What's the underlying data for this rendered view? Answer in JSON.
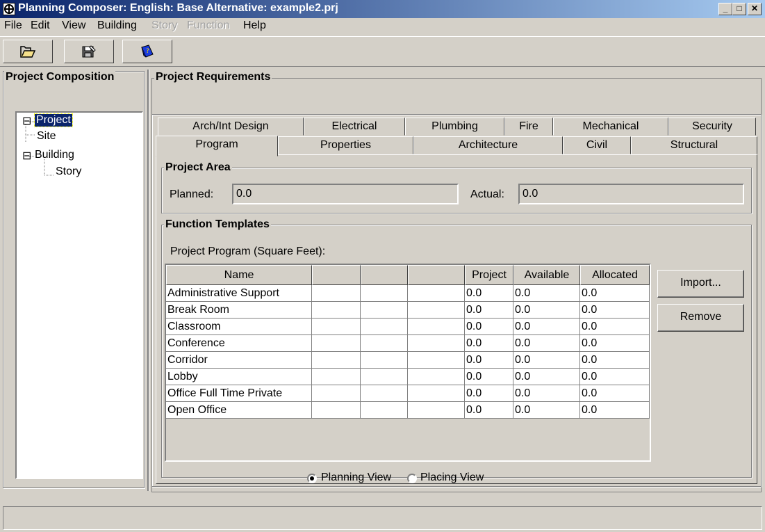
{
  "window": {
    "title": "Planning Composer: English: Base Alternative: example2.prj",
    "minimize": "_",
    "maximize": "□",
    "close": "✕"
  },
  "menu": [
    {
      "label": "File",
      "enabled": true
    },
    {
      "label": "Edit",
      "enabled": true
    },
    {
      "label": "View",
      "enabled": true
    },
    {
      "label": "Building",
      "enabled": true
    },
    {
      "label": "Story",
      "enabled": false
    },
    {
      "label": "Function",
      "enabled": false
    },
    {
      "label": "Help",
      "enabled": true
    }
  ],
  "toolbar": {
    "icons": [
      "open-folder-icon",
      "save-edit-icon",
      "help-book-icon"
    ]
  },
  "project_composition": {
    "title": "Project Composition",
    "tree": [
      {
        "label": "Project",
        "selected": true,
        "expander": "⊟"
      },
      {
        "label": "Site"
      },
      {
        "label": "Building",
        "expander": "⊟"
      },
      {
        "label": "Story"
      }
    ]
  },
  "project_requirements": {
    "title": "Project Requirements",
    "tabs_back": [
      "Arch/Int Design",
      "Electrical",
      "Plumbing",
      "Fire",
      "Mechanical",
      "Security"
    ],
    "tabs_front": [
      "Program",
      "Properties",
      "Architecture",
      "Civil",
      "Structural"
    ],
    "active_tab": "Program"
  },
  "project_area": {
    "title": "Project Area",
    "planned_label": "Planned:",
    "planned_value": "0.0",
    "actual_label": "Actual:",
    "actual_value": "0.0"
  },
  "function_templates": {
    "title": "Function Templates",
    "subtitle": "Project Program (Square Feet):",
    "columns": [
      "Name",
      "",
      "",
      "",
      "Project",
      "Available",
      "Allocated"
    ],
    "rows": [
      [
        "Administrative Support",
        "",
        "",
        "",
        "0.0",
        "0.0",
        "0.0"
      ],
      [
        "Break Room",
        "",
        "",
        "",
        "0.0",
        "0.0",
        "0.0"
      ],
      [
        "Classroom",
        "",
        "",
        "",
        "0.0",
        "0.0",
        "0.0"
      ],
      [
        "Conference",
        "",
        "",
        "",
        "0.0",
        "0.0",
        "0.0"
      ],
      [
        "Corridor",
        "",
        "",
        "",
        "0.0",
        "0.0",
        "0.0"
      ],
      [
        "Lobby",
        "",
        "",
        "",
        "0.0",
        "0.0",
        "0.0"
      ],
      [
        "Office Full Time Private",
        "",
        "",
        "",
        "0.0",
        "0.0",
        "0.0"
      ],
      [
        "Open Office",
        "",
        "",
        "",
        "0.0",
        "0.0",
        "0.0"
      ]
    ],
    "import_label": "Import...",
    "remove_label": "Remove",
    "view_options": [
      {
        "label": "Planning View",
        "checked": true
      },
      {
        "label": "Placing View",
        "checked": false
      }
    ]
  },
  "status_bar": {
    "text": ""
  }
}
